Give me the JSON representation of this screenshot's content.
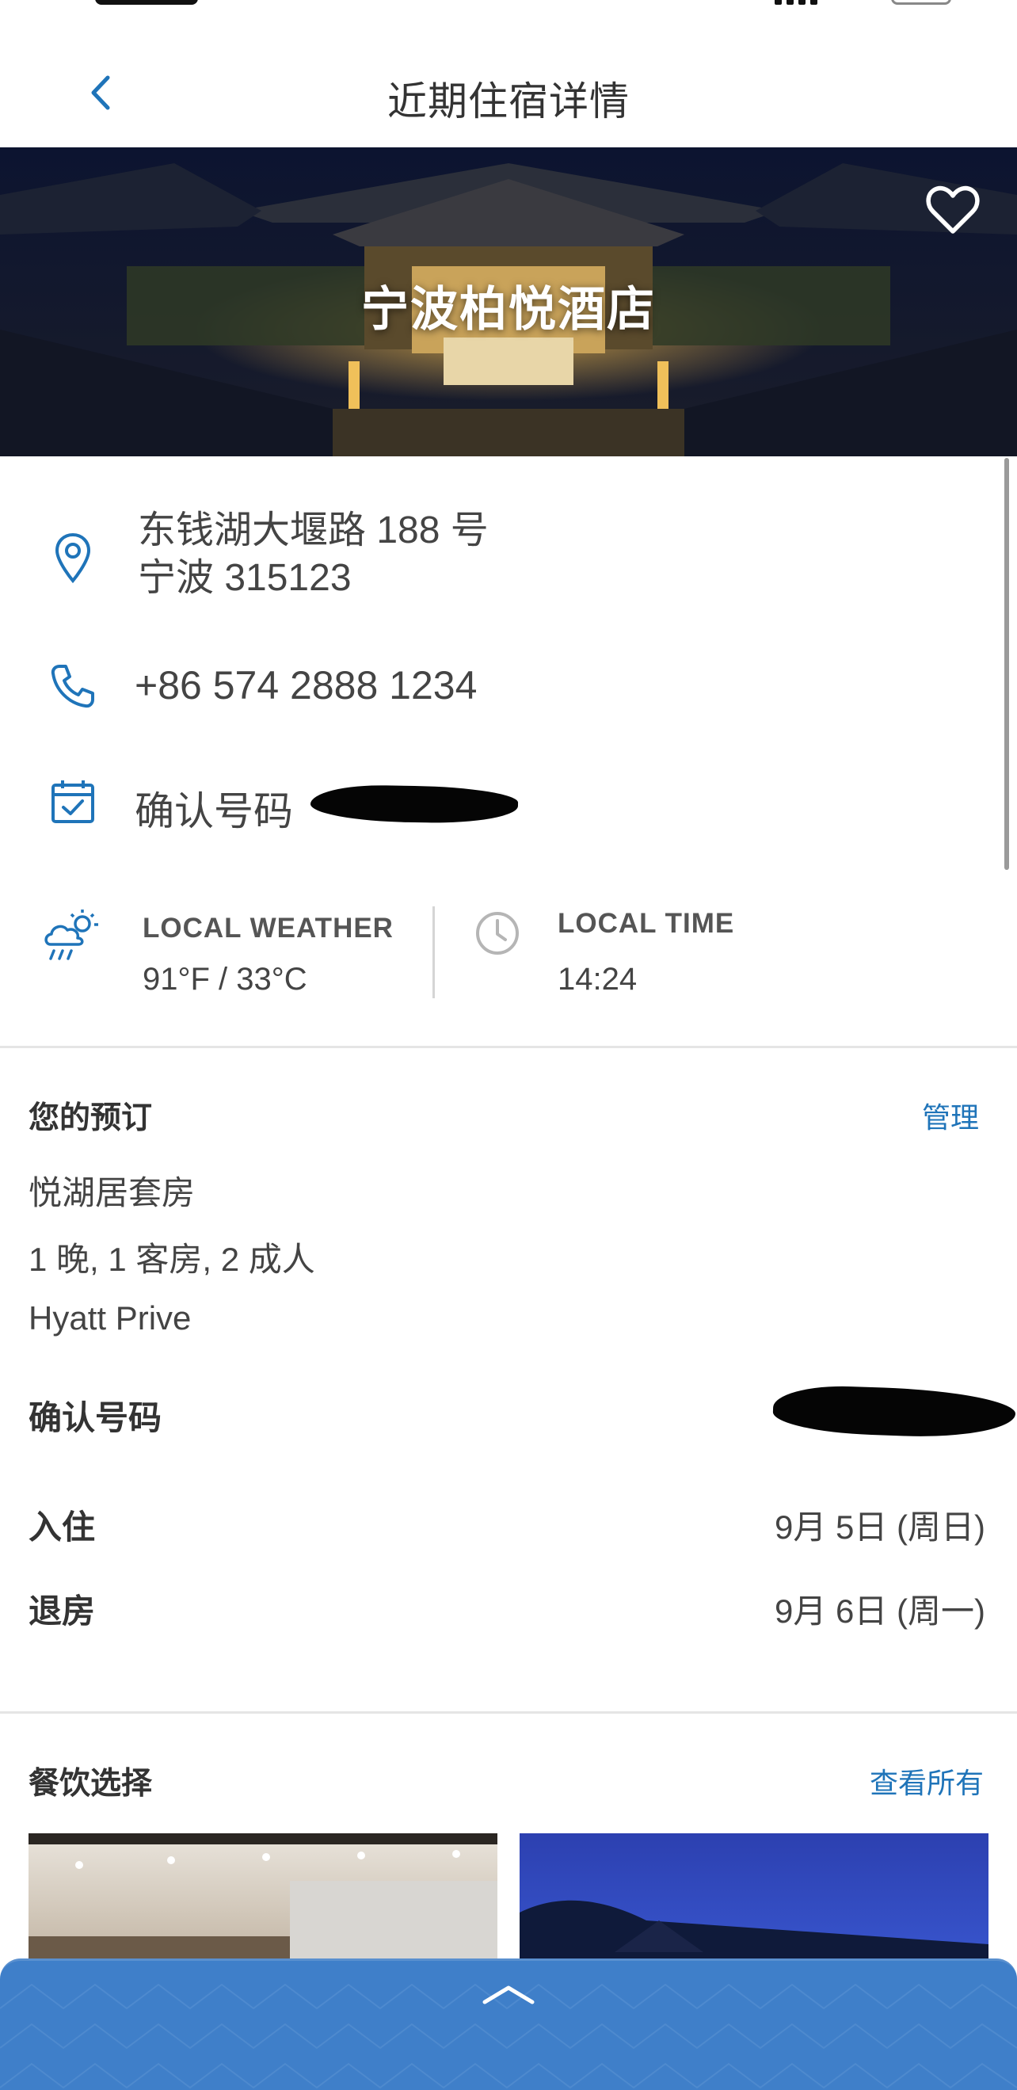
{
  "nav": {
    "title": "近期住宿详情"
  },
  "hero": {
    "hotel_name": "宁波柏悦酒店"
  },
  "address": {
    "line1": "东钱湖大堰路 188 号",
    "line2": "宁波 315123"
  },
  "phone": "+86 574 2888 1234",
  "confirmation_label": "确认号码",
  "weather": {
    "label": "LOCAL WEATHER",
    "value": "91°F / 33°C"
  },
  "local_time": {
    "label": "LOCAL TIME",
    "value": "14:24"
  },
  "reservation": {
    "title": "您的预订",
    "manage_label": "管理",
    "room_type": "悦湖居套房",
    "summary": "1 晚, 1 客房, 2  成人",
    "rate": "Hyatt Prive",
    "confirmation_label": "确认号码",
    "checkin_label": "入住",
    "checkin_value": "9月 5日 (周日)",
    "checkout_label": "退房",
    "checkout_value": "9月 6日 (周一)"
  },
  "dining": {
    "title": "餐饮选择",
    "view_all_label": "查看所有"
  },
  "colors": {
    "accent": "#1f74b9",
    "drawer": "#3f7fc9"
  }
}
